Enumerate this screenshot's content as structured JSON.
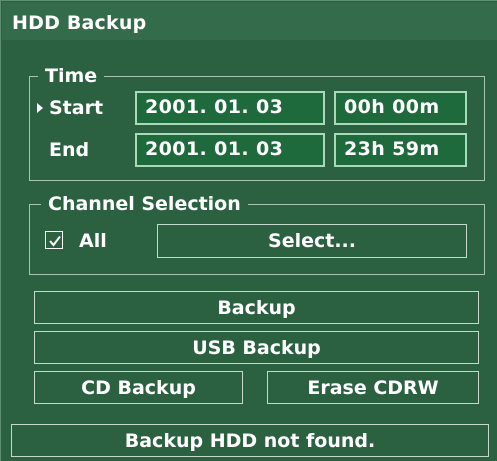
{
  "window": {
    "title": "HDD Backup"
  },
  "time": {
    "legend": "Time",
    "start_label": "Start",
    "end_label": "End",
    "start_date": "2001. 01. 03",
    "start_time": "00h 00m",
    "end_date": "2001. 01. 03",
    "end_time": "23h 59m"
  },
  "channel": {
    "legend": "Channel Selection",
    "all_label": "All",
    "all_checked": true,
    "select_label": "Select..."
  },
  "actions": {
    "backup_label": "Backup",
    "usb_backup_label": "USB Backup",
    "cd_backup_label": "CD Backup",
    "erase_cdrw_label": "Erase CDRW"
  },
  "status": {
    "message": "Backup HDD not found."
  },
  "colors": {
    "background": "#2b6141",
    "field_fill": "#1f6a3c",
    "field_border": "#a8d9b8",
    "text": "#ffffff"
  }
}
